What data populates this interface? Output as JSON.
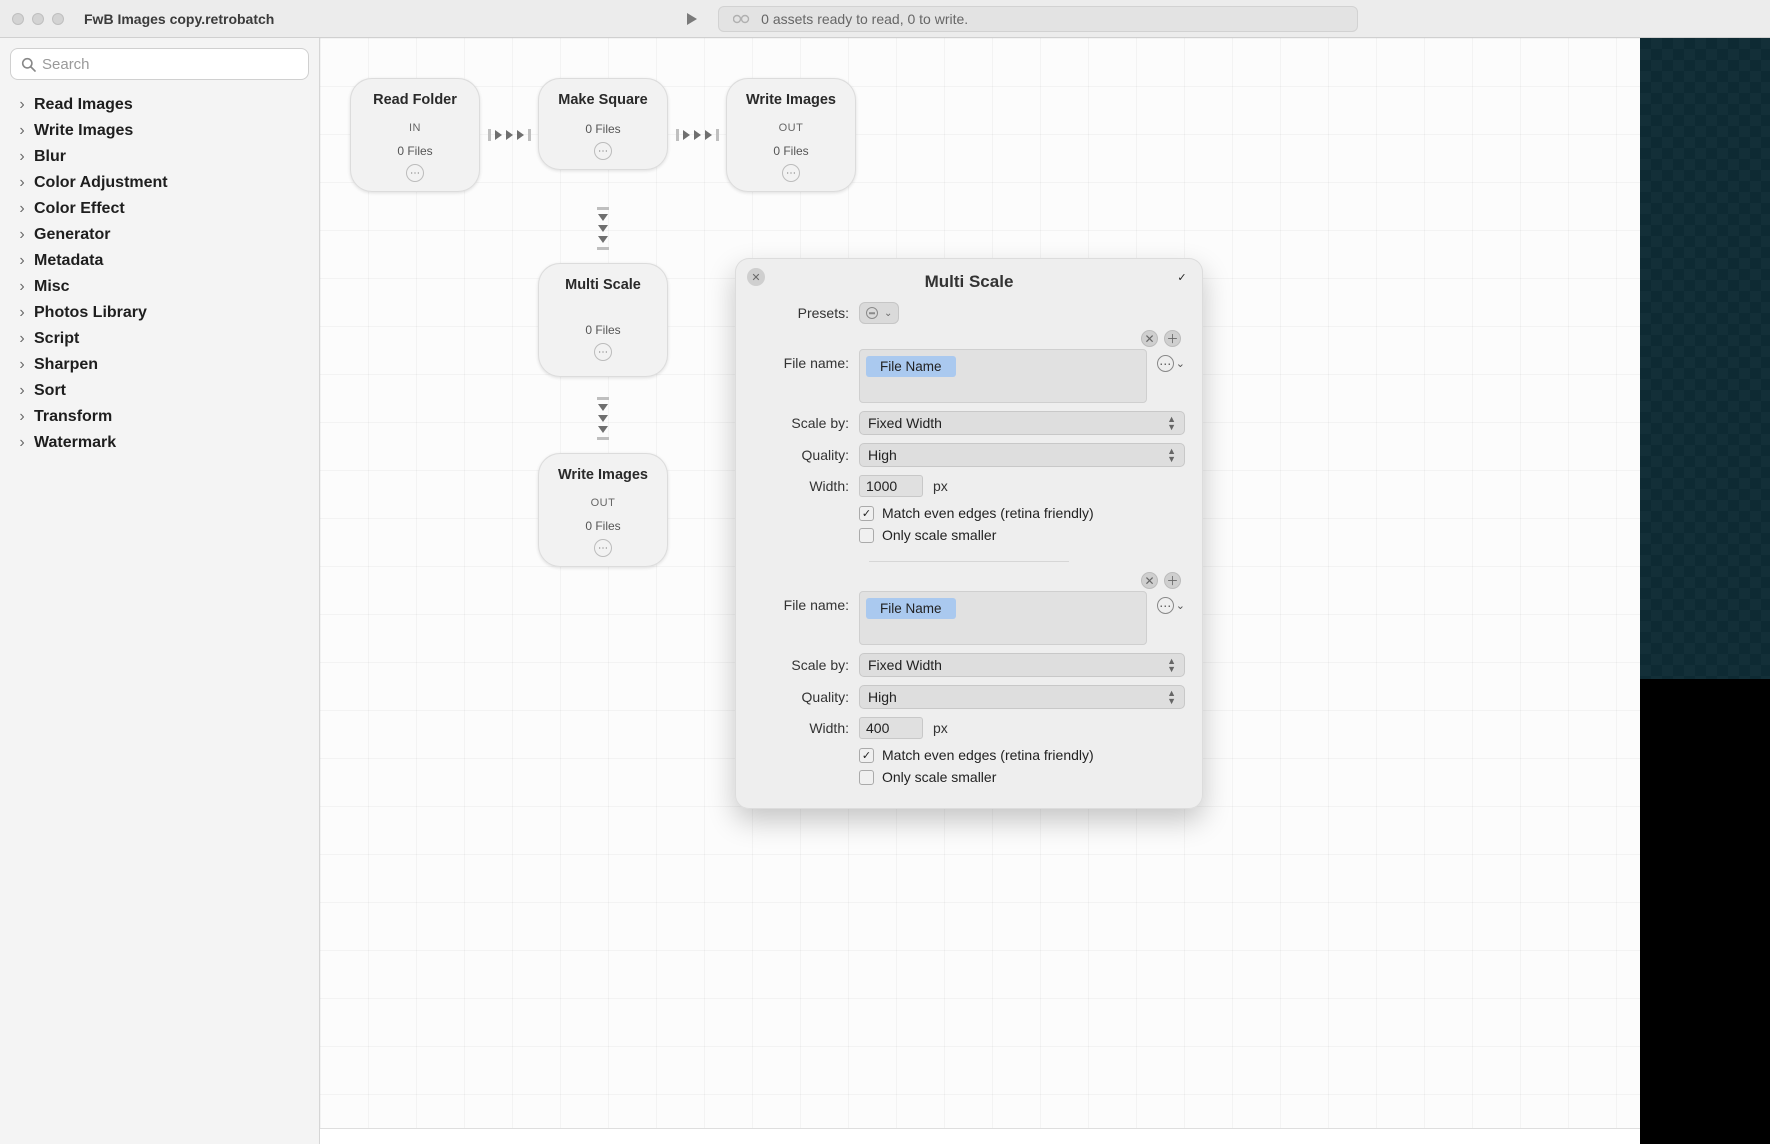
{
  "titlebar": {
    "title": "FwB Images copy.retrobatch",
    "status": "0 assets ready to read, 0 to write."
  },
  "sidebar": {
    "search_placeholder": "Search",
    "categories": [
      "Read Images",
      "Write Images",
      "Blur",
      "Color Adjustment",
      "Color Effect",
      "Generator",
      "Metadata",
      "Misc",
      "Photos Library",
      "Script",
      "Sharpen",
      "Sort",
      "Transform",
      "Watermark"
    ]
  },
  "nodes": {
    "read_folder": {
      "title": "Read Folder",
      "tag": "IN",
      "sub": "0 Files"
    },
    "make_square": {
      "title": "Make Square",
      "tag": "",
      "sub": "0 Files"
    },
    "write_images": {
      "title": "Write Images",
      "tag": "OUT",
      "sub": "0 Files"
    },
    "multi_scale": {
      "title": "Multi Scale",
      "tag": "",
      "sub": "0 Files"
    },
    "write_images2": {
      "title": "Write Images",
      "tag": "OUT",
      "sub": "0 Files"
    }
  },
  "inspector": {
    "title": "Multi Scale",
    "labels": {
      "presets": "Presets:",
      "file_name": "File name:",
      "scale_by": "Scale by:",
      "quality": "Quality:",
      "width": "Width:",
      "px": "px",
      "match_edges": "Match even edges (retina friendly)",
      "only_smaller": "Only scale smaller"
    },
    "token": "File Name",
    "presets": [
      {
        "scale_by": "Fixed Width",
        "quality": "High",
        "width": "1000",
        "match_edges": true,
        "only_smaller": false
      },
      {
        "scale_by": "Fixed Width",
        "quality": "High",
        "width": "400",
        "match_edges": true,
        "only_smaller": false
      }
    ]
  }
}
